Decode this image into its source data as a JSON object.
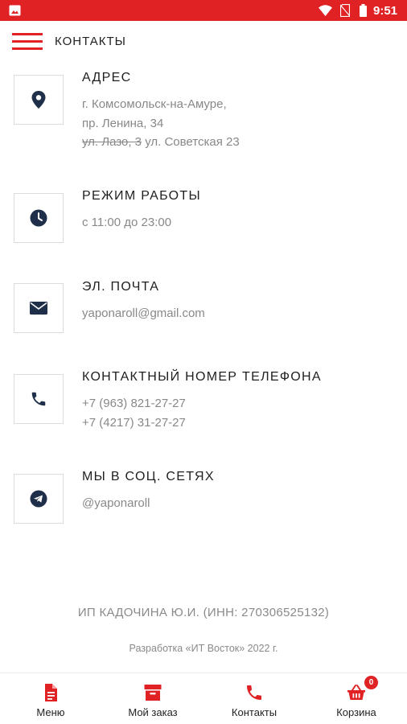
{
  "status_bar": {
    "time": "9:51",
    "icons": [
      "gallery-icon",
      "wifi-icon",
      "no-sim-icon",
      "battery-icon"
    ],
    "background": "#e02224"
  },
  "header": {
    "title": "КОНТАКТЫ",
    "menu_icon": "hamburger-icon"
  },
  "sections": [
    {
      "id": "address",
      "icon": "location-pin-icon",
      "title": "АДРЕС",
      "line1": "г. Комсомольск-на-Амуре,",
      "line2": "пр. Ленина, 34",
      "old_address": "ул. Лазо, 3",
      "new_address": "ул. Советская 23"
    },
    {
      "id": "hours",
      "icon": "clock-icon",
      "title": "РЕЖИМ РАБОТЫ",
      "line1": "с 11:00 до 23:00"
    },
    {
      "id": "email",
      "icon": "envelope-icon",
      "title": "ЭЛ. ПОЧТА",
      "line1": "yaponaroll@gmail.com"
    },
    {
      "id": "phone",
      "icon": "phone-icon",
      "title": "КОНТАКТНЫЙ НОМЕР ТЕЛЕФОНА",
      "line1": "+7 (963) 821-27-27",
      "line2": "+7 (4217) 31-27-27"
    },
    {
      "id": "social",
      "icon": "telegram-icon",
      "title": "МЫ В СОЦ. СЕТЯХ",
      "line1": "@yaponaroll"
    }
  ],
  "footer": {
    "legal": "ИП КАДОЧИНА Ю.И. (ИНН: 270306525132)",
    "developer": "Разработка «ИТ Восток» 2022 г."
  },
  "bottom_nav": {
    "items": [
      {
        "label": "Меню",
        "icon": "document-icon"
      },
      {
        "label": "Мой заказ",
        "icon": "archive-box-icon"
      },
      {
        "label": "Контакты",
        "icon": "phone-icon"
      },
      {
        "label": "Корзина",
        "icon": "basket-icon",
        "badge": "0"
      }
    ]
  },
  "colors": {
    "accent": "#e02224",
    "icon_dark": "#1f2f4a",
    "text_muted": "#888888"
  }
}
